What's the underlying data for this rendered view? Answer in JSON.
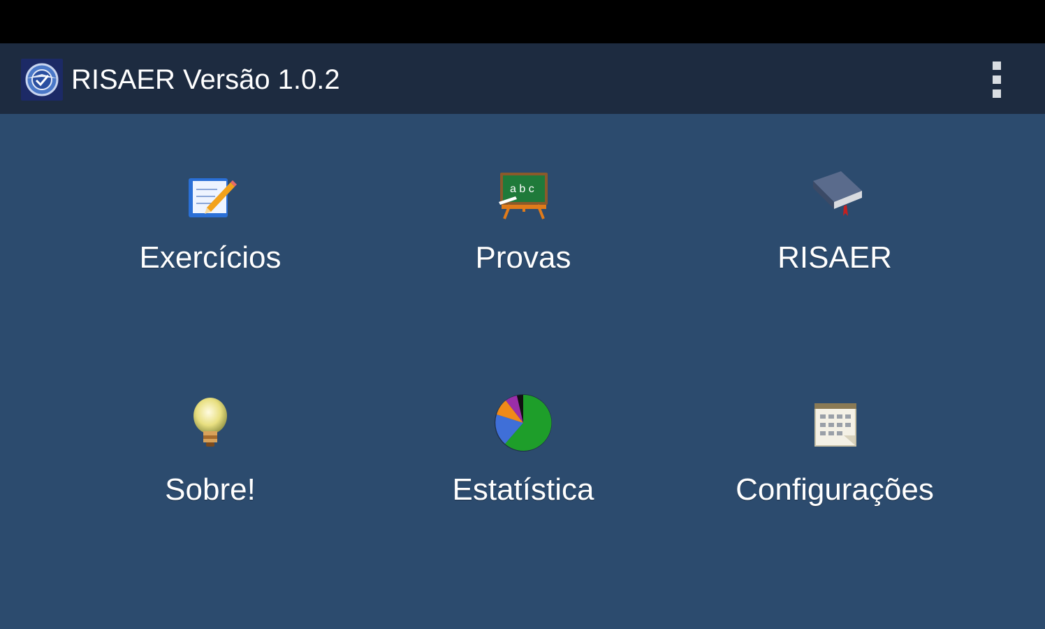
{
  "action_bar": {
    "title": "RISAER Versão 1.0.2",
    "app_icon": "shield-emblem-icon",
    "overflow_icon": "more-vertical-icon"
  },
  "menu": {
    "items": [
      {
        "label": "Exercícios",
        "icon": "notepad-pencil-icon"
      },
      {
        "label": "Provas",
        "icon": "chalkboard-abc-icon"
      },
      {
        "label": "RISAER",
        "icon": "book-icon"
      },
      {
        "label": "Sobre!",
        "icon": "lightbulb-icon"
      },
      {
        "label": "Estatística",
        "icon": "pie-chart-icon"
      },
      {
        "label": "Configurações",
        "icon": "calendar-settings-icon"
      }
    ]
  },
  "colors": {
    "status_bar": "#000000",
    "action_bar": "#1d2b40",
    "background": "#2c4b6e",
    "text": "#ffffff"
  }
}
